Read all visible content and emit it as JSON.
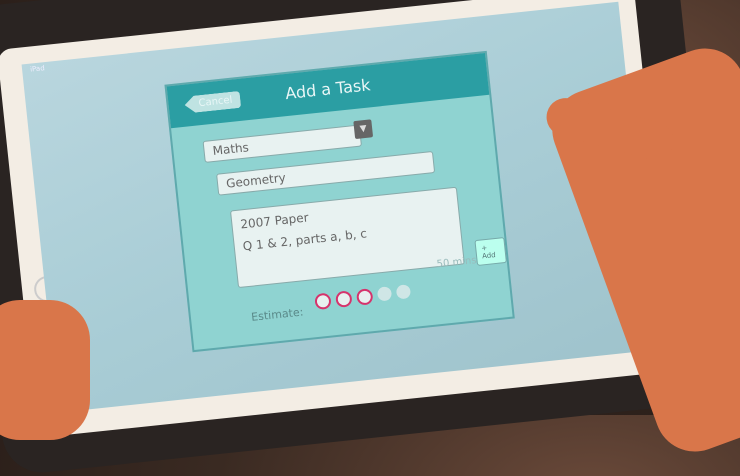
{
  "status_bar": {
    "carrier": "iPad"
  },
  "dialog": {
    "title": "Add a Task",
    "cancel_label": "Cancel",
    "subject_select": {
      "value": "Maths",
      "icon": "triangle-down-icon"
    },
    "topic_field": {
      "value": "Geometry"
    },
    "notes_field": {
      "lines": [
        "2007 Paper",
        "Q 1 & 2, parts a, b, c"
      ]
    },
    "add_label": "+ Add",
    "duration_label": "50 mins",
    "estimate": {
      "label": "Estimate:",
      "filled": 3,
      "total": 5
    },
    "colors": {
      "header": "#2b9ea3",
      "body": "#8fd3d1",
      "estimate_accent": "#d6336c"
    }
  }
}
